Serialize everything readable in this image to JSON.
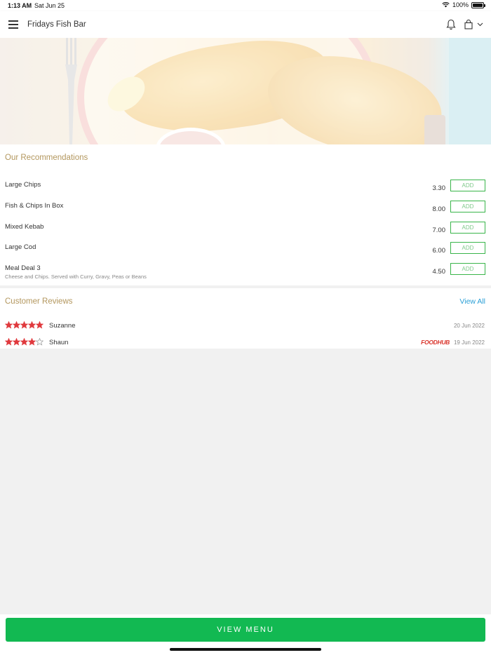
{
  "status_bar": {
    "time": "1:13 AM",
    "date": "Sat Jun 25",
    "battery": "100%",
    "battery_level": 1.0
  },
  "header": {
    "title": "Fridays Fish Bar",
    "icons": [
      "menu-icon",
      "bell-icon",
      "shopping-bag-icon",
      "chevron-down-icon"
    ]
  },
  "recommendations": {
    "title": "Our Recommendations",
    "items": [
      {
        "name": "Large Chips",
        "description": "",
        "price": "3.30",
        "add_label": "ADD"
      },
      {
        "name": "Fish & Chips In Box",
        "description": "",
        "price": "8.00",
        "add_label": "ADD"
      },
      {
        "name": "Mixed Kebab",
        "description": "",
        "price": "7.00",
        "add_label": "ADD"
      },
      {
        "name": "Large Cod",
        "description": "",
        "price": "6.00",
        "add_label": "ADD"
      },
      {
        "name": "Meal Deal 3",
        "description": "Cheese and Chips. Served with Curry, Gravy, Peas or Beans",
        "price": "4.50",
        "add_label": "ADD"
      }
    ]
  },
  "reviews": {
    "title": "Customer Reviews",
    "view_all": "View All",
    "items": [
      {
        "reviewer": "Suzanne",
        "rating": 5,
        "date": "20 Jun 2022",
        "source": ""
      },
      {
        "reviewer": "Shaun",
        "rating": 4,
        "date": "19 Jun 2022",
        "source": "FOODHUB"
      }
    ]
  },
  "footer": {
    "button_label": "VIEW MENU"
  },
  "colors": {
    "accent_green": "#12b952",
    "section_title": "#b3975e",
    "link_blue": "#2a9fd6",
    "star_red": "#e03a3e"
  }
}
